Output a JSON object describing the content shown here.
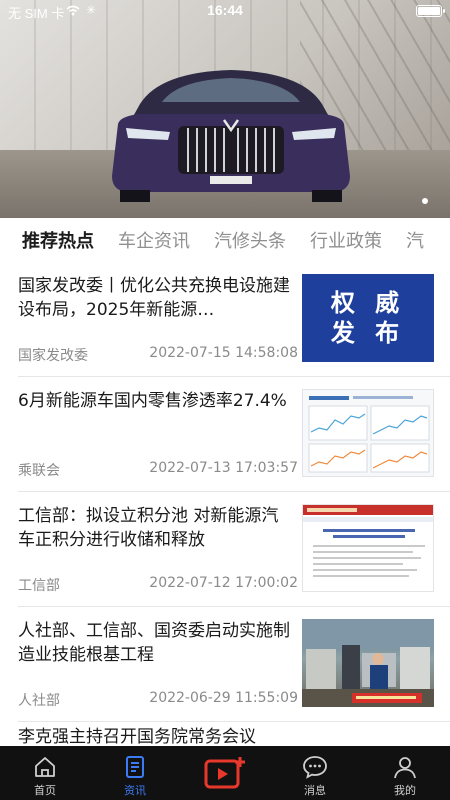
{
  "status_bar": {
    "carrier": "无 SIM 卡",
    "time": "16:44"
  },
  "banner": {
    "slide_count": 1,
    "active_slide": 1
  },
  "tabs": [
    {
      "label": "推荐热点",
      "active": true
    },
    {
      "label": "车企资讯",
      "active": false
    },
    {
      "label": "汽修头条",
      "active": false
    },
    {
      "label": "行业政策",
      "active": false
    },
    {
      "label": "汽",
      "active": false
    }
  ],
  "news": [
    {
      "title": "国家发改委丨优化公共充换电设施建设布局，2025年新能源…",
      "source": "国家发改委",
      "date": "2022-07-15 14:58:08",
      "thumb_text": [
        "权 威",
        "发 布"
      ]
    },
    {
      "title": "6月新能源车国内零售渗透率27.4%",
      "source": "乘联会",
      "date": "2022-07-13 17:03:57"
    },
    {
      "title": "工信部：拟设立积分池 对新能源汽车正积分进行收储和释放",
      "source": "工信部",
      "date": "2022-07-12 17:00:02"
    },
    {
      "title": "人社部、工信部、国资委启动实施制造业技能根基工程",
      "source": "人社部",
      "date": "2022-06-29 11:55:09"
    }
  ],
  "partial_item_title": "李克强主持召开国务院常务会议",
  "bottom_nav": [
    {
      "label": "首页",
      "icon": "home-icon",
      "active": false
    },
    {
      "label": "资讯",
      "icon": "news-icon",
      "active": true
    },
    {
      "label": "",
      "icon": "video-add-icon",
      "active": false
    },
    {
      "label": "消息",
      "icon": "message-icon",
      "active": false
    },
    {
      "label": "我的",
      "icon": "profile-icon",
      "active": false
    }
  ],
  "colors": {
    "accent": "#3b7cf5",
    "video_icon": "#e8382b",
    "bottom_bar": "#111111"
  }
}
